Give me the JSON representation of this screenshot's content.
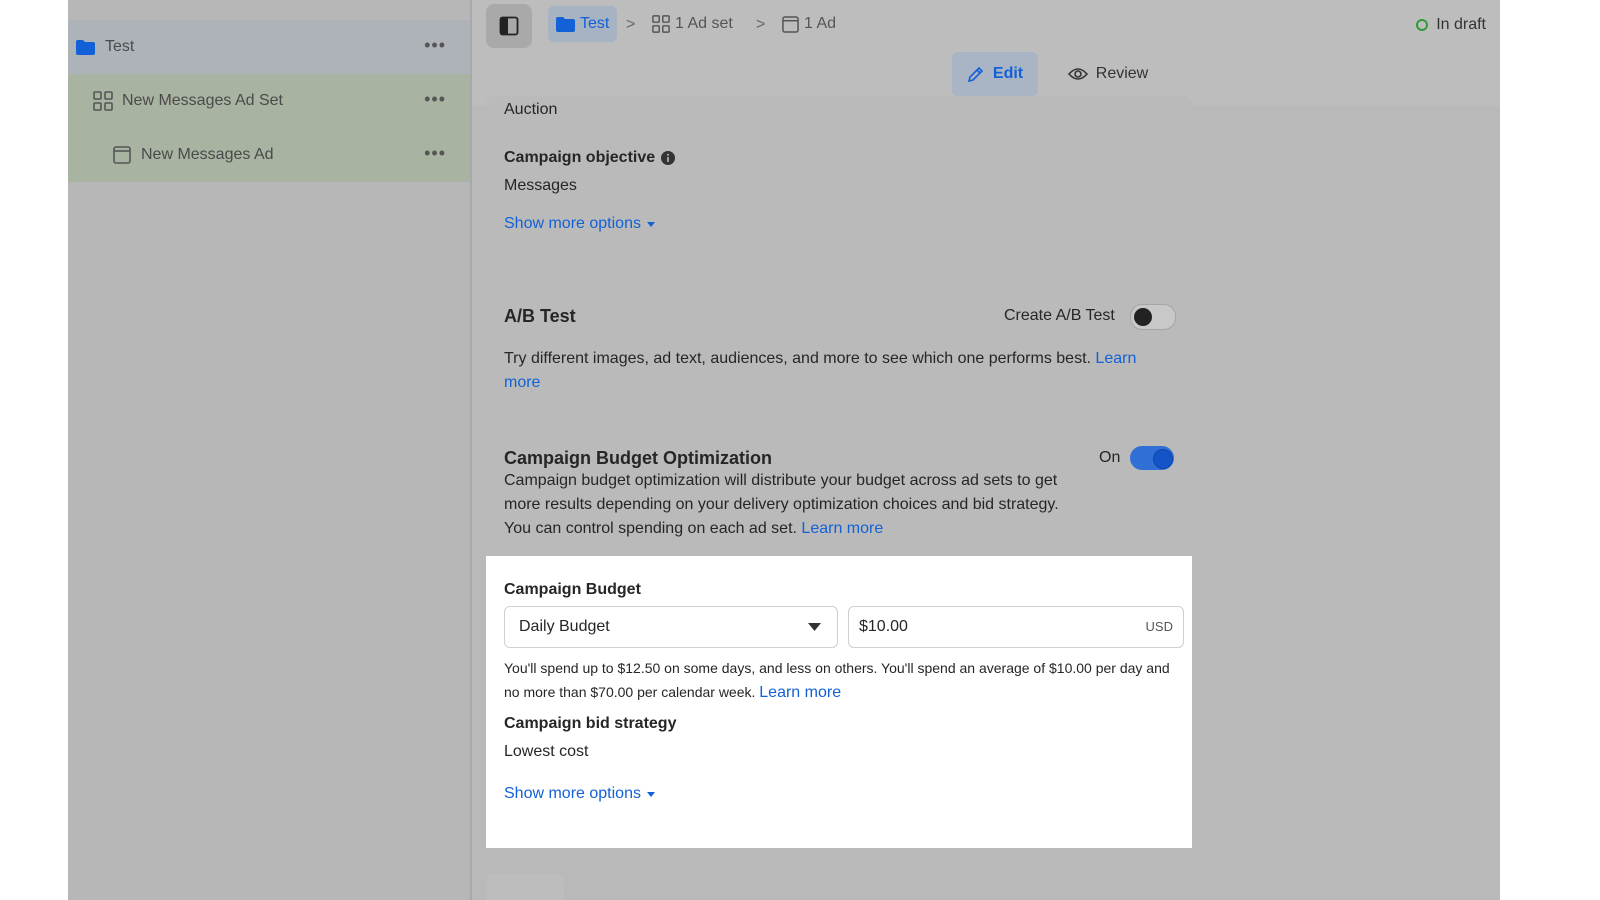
{
  "sidebar": {
    "campaign": {
      "label": "Test",
      "more": "•••"
    },
    "adset": {
      "label": "New Messages Ad Set",
      "more": "•••"
    },
    "ad": {
      "label": "New Messages Ad",
      "more": "•••"
    }
  },
  "breadcrumb": {
    "campaign": "Test",
    "adset": "1 Ad set",
    "ad": "1 Ad",
    "separator": ">"
  },
  "status": "In draft",
  "modes": {
    "edit": "Edit",
    "review": "Review"
  },
  "campaign_card": {
    "buying_type_value": "Auction",
    "objective_label": "Campaign objective",
    "objective_value": "Messages",
    "show_more": "Show more options"
  },
  "ab_test": {
    "title": "A/B Test",
    "toggle_label": "Create A/B Test",
    "toggle_on": false,
    "description": "Try different images, ad text, audiences, and more to see which one performs best.",
    "learn_more_1": "Learn",
    "learn_more_2": "more"
  },
  "cbo": {
    "title": "Campaign Budget Optimization",
    "toggle_label": "On",
    "toggle_on": true,
    "desc_line1": "Campaign budget optimization will distribute your budget across ad sets to get",
    "desc_line2": "more results depending on your delivery optimization choices and bid strategy.",
    "desc_line3": "You can control spending on each ad set.",
    "learn_more": "Learn more"
  },
  "budget": {
    "label": "Campaign Budget",
    "type": "Daily Budget",
    "amount": "$10.00",
    "currency": "USD",
    "note_line1": "You'll spend up to $12.50 on some days, and less on others. You'll spend an average of $10.00 per day and",
    "note_line2": "no more than $70.00 per calendar week.",
    "learn_more": "Learn more",
    "bid_label": "Campaign bid strategy",
    "bid_value": "Lowest cost",
    "show_more": "Show more options"
  },
  "colors": {
    "accent": "#1261d6",
    "status_green": "#2f9b3a"
  }
}
